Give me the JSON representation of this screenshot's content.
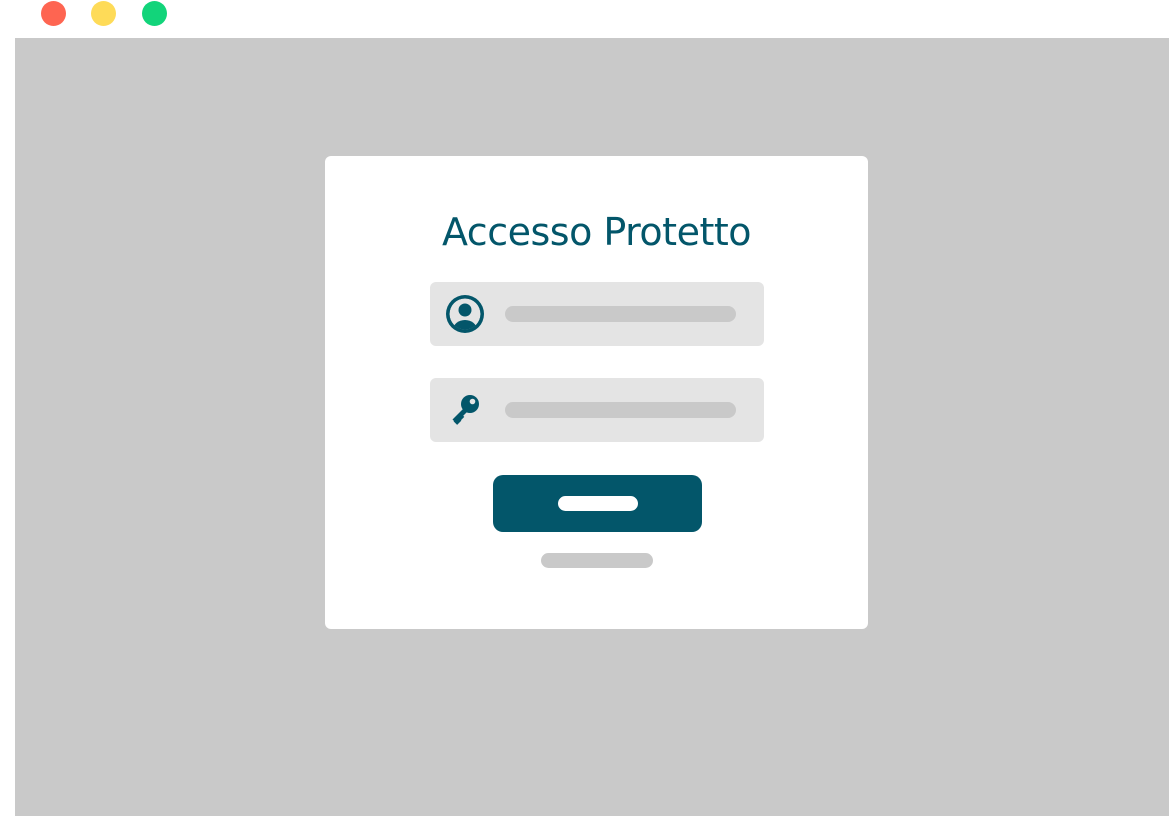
{
  "window": {
    "controls": {
      "close_color": "#fe6551",
      "minimize_color": "#fedb58",
      "zoom_color": "#12d47a"
    }
  },
  "login": {
    "title": "Accesso Protetto",
    "title_color": "#03566a",
    "accent_color": "#03566a",
    "username_field": {
      "icon": "user-circle-icon",
      "value": "",
      "placeholder": ""
    },
    "password_field": {
      "icon": "key-icon",
      "value": "",
      "placeholder": ""
    },
    "submit_button": {
      "label": ""
    },
    "footer_link": {
      "label": ""
    }
  }
}
